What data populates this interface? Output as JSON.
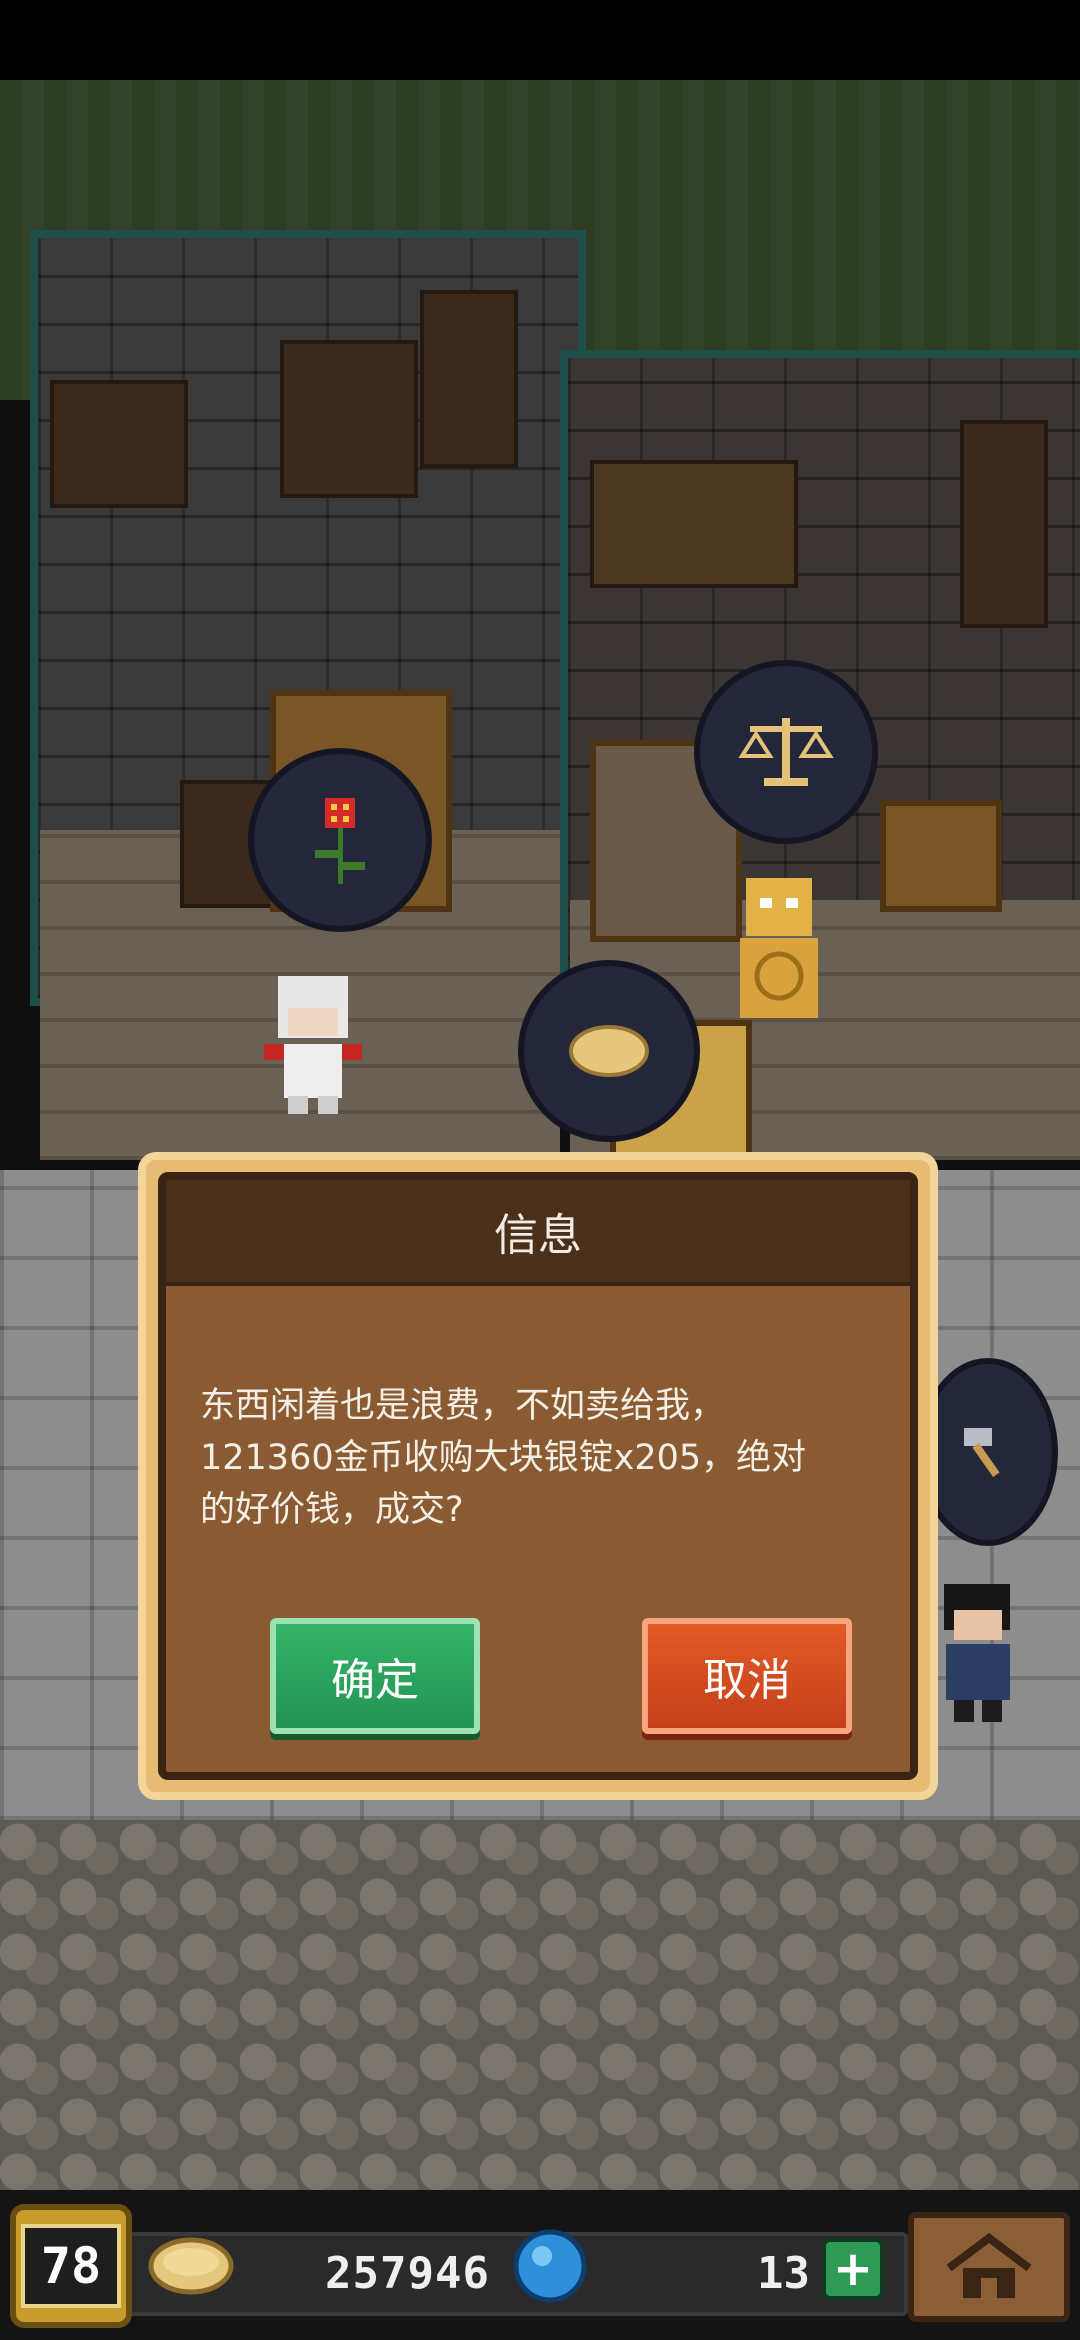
{
  "dialog": {
    "title": "信息",
    "message": "东西闲着也是浪费，不如卖给我，\n121360金币收购大块银锭x205，绝对\n的好价钱，成交?",
    "confirm_label": "确定",
    "cancel_label": "取消"
  },
  "hud": {
    "level": "78",
    "gold": "257946",
    "gems": "13",
    "add_icon": "plus-icon",
    "home_icon": "home-icon",
    "coin_icon": "coin-icon",
    "gem_icon": "gem-icon"
  },
  "scene": {
    "bubbles": [
      "flower-icon",
      "scales-icon",
      "bread-icon",
      "hammer-icon"
    ]
  },
  "colors": {
    "confirm": "#239451",
    "cancel": "#c4401b",
    "dialog_frame": "#e7bb74",
    "dialog_body": "#8a5b32"
  }
}
